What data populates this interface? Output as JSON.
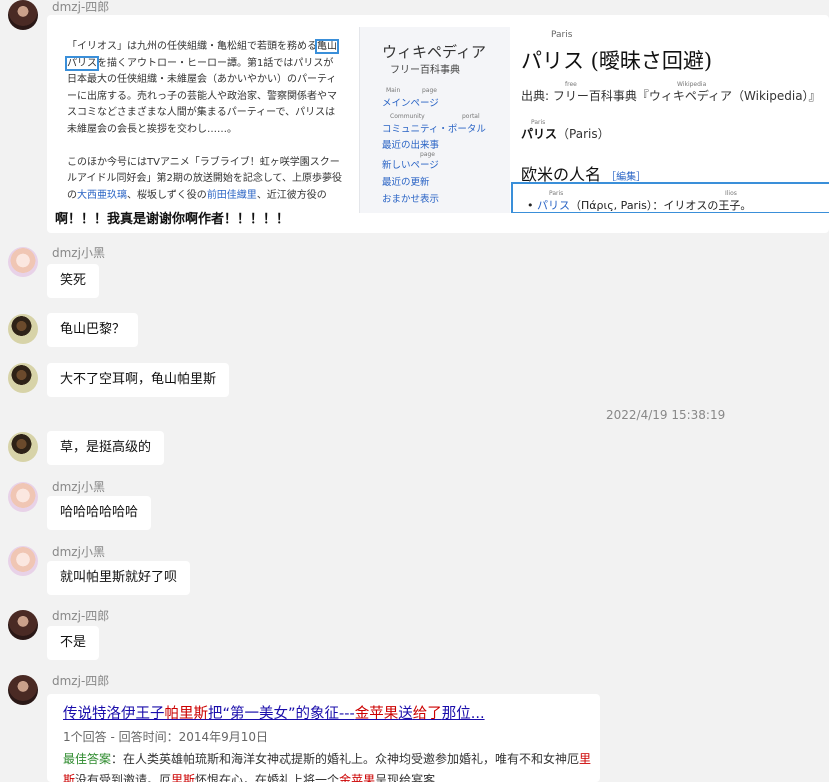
{
  "messages": {
    "m1": {
      "sender": "dmzj-四郎",
      "caption": "啊！！！我真是谢谢你啊作者！！！！！"
    },
    "m2": {
      "sender": "dmzj小黑",
      "text": "笑死"
    },
    "m3": {
      "text": "龟山巴黎？"
    },
    "m4": {
      "text": "大不了空耳啊，龟山帕里斯"
    },
    "timestamp": "2022/4/19 15:38:19",
    "m5": {
      "text": "草，是挺高级的"
    },
    "m6": {
      "sender": "dmzj小黑",
      "text": "哈哈哈哈哈哈"
    },
    "m7": {
      "sender": "dmzj小黑",
      "text": "就叫帕里斯就好了呗"
    },
    "m8": {
      "sender": "dmzj-四郎",
      "text": "不是"
    },
    "m9": {
      "sender": "dmzj-四郎"
    }
  },
  "shot": {
    "jp_line1_a": "「イリオス」は九州の任侠組織・亀松組で若頭を務める",
    "jp_hl1": "亀山",
    "jp_hl2": "パリス",
    "jp_line2_b": "を描くアウトロー・ヒーロー譚。第1話ではパリスが日本最大の任侠組織・未維屋会（あかいやかい）のパーティーに出席する。売れっ子の芸能人や政治家、警察関係者やマスコミなどさまざまな人間が集まるパーティーで、パリスは未維屋会の会長と挨拶を交わし……。",
    "jp_para2_a": "このほか今号にはTVアニメ「ラブライブ！虹ヶ咲学園スクールアイドル同好会」第2期の放送開始を記念して、上原歩夢役の",
    "jp_link1": "大西亜玖璃",
    "jp_para2_b": "、桜坂しずく役の",
    "jp_link2": "前田佳織里",
    "jp_para2_c": "、近江彼方役の",
    "wiki_logo": "ウィキペディア",
    "wiki_sub": "フリー百科事典",
    "nav": [
      "メインページ",
      "コミュニティ・ポータル",
      "最近の出来事",
      "新しいページ",
      "最近の更新",
      "おまかせ表示"
    ],
    "tiny_main": "Main",
    "tiny_page": "page",
    "tiny_community": "Community",
    "tiny_portal": "portal",
    "tiny_paris_top": "Paris",
    "tiny_free": "free",
    "tiny_wikipedia": "Wikipedia",
    "tiny_paris2": "Paris",
    "tiny_paris3": "Paris",
    "tiny_ilios": "Ilios",
    "tiny_page2": "page",
    "title": "パリス (曖昧さ回避)",
    "source": "出典: フリー百科事典『ウィキペディア（Wikipedia）』",
    "bold_word": "パリス",
    "bold_rest": "（Paris）",
    "section": "欧米の人名",
    "edit": "［編集］",
    "li_link": "パリス",
    "li_rest": "（Πάρις, Paris）：イリオスの王子。"
  },
  "link_card": {
    "title_1": "传说特洛伊王子",
    "title_red1": "帕里斯",
    "title_2": "把“第一美女”的象征---",
    "title_red2": "金苹果",
    "title_3": "送",
    "title_red3": "给了",
    "title_4": "那位...",
    "meta": "1个回答 - 回答时间：2014年9月10日",
    "answer_label": "最佳答案",
    "answer_1": "：在人类英雄帕琉斯和海洋女神忒提斯的婚礼上。众神均受邀参加婚礼，唯有不和女",
    "answer_2": "神厄",
    "answer_red1": "里斯",
    "answer_3": "没有受到邀请。厄",
    "answer_red2": "里斯",
    "answer_4": "怀恨在心，在婚礼上将一个",
    "answer_red3": "金苹果",
    "answer_5": "呈现给宴客"
  }
}
